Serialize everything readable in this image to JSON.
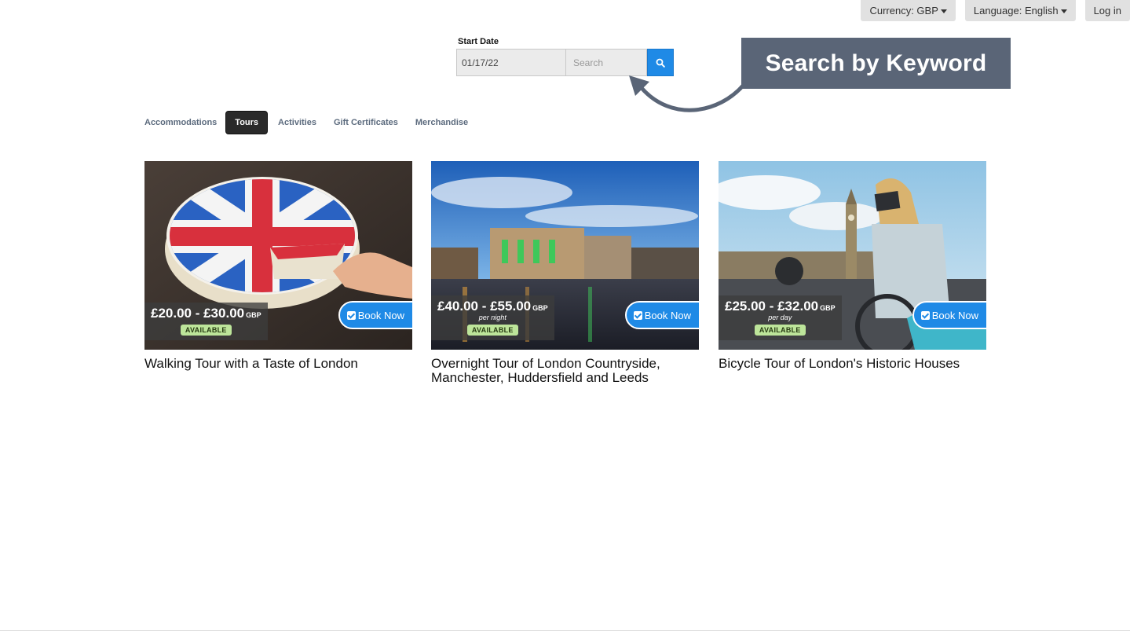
{
  "topbar": {
    "currency_label": "Currency: GBP",
    "language_label": "Language: English",
    "login_label": "Log in"
  },
  "search": {
    "date_label": "Start Date",
    "date_value": "01/17/22",
    "keyword_placeholder": "Search"
  },
  "callout": {
    "text": "Search by Keyword"
  },
  "tabs": [
    {
      "label": "Accommodations",
      "active": false
    },
    {
      "label": "Tours",
      "active": true
    },
    {
      "label": "Activities",
      "active": false
    },
    {
      "label": "Gift Certificates",
      "active": false
    },
    {
      "label": "Merchandise",
      "active": false
    }
  ],
  "cards": [
    {
      "price": "£20.00 - £30.00",
      "currency": "GBP",
      "per": "",
      "status": "AVAILABLE",
      "book_label": "Book Now",
      "title": "Walking Tour with a Taste of London"
    },
    {
      "price": "£40.00 - £55.00",
      "currency": "GBP",
      "per": "per night",
      "status": "AVAILABLE",
      "book_label": "Book Now",
      "title": "Overnight Tour of London Countryside, Manchester, Huddersfield and Leeds"
    },
    {
      "price": "£25.00 - £32.00",
      "currency": "GBP",
      "per": "per day",
      "status": "AVAILABLE",
      "book_label": "Book Now",
      "title": "Bicycle Tour of London's Historic Houses"
    }
  ],
  "colors": {
    "accent": "#1f8ae6",
    "callout": "#5a6577",
    "available_badge": "#bde59a",
    "active_tab": "#2a2a2a"
  }
}
